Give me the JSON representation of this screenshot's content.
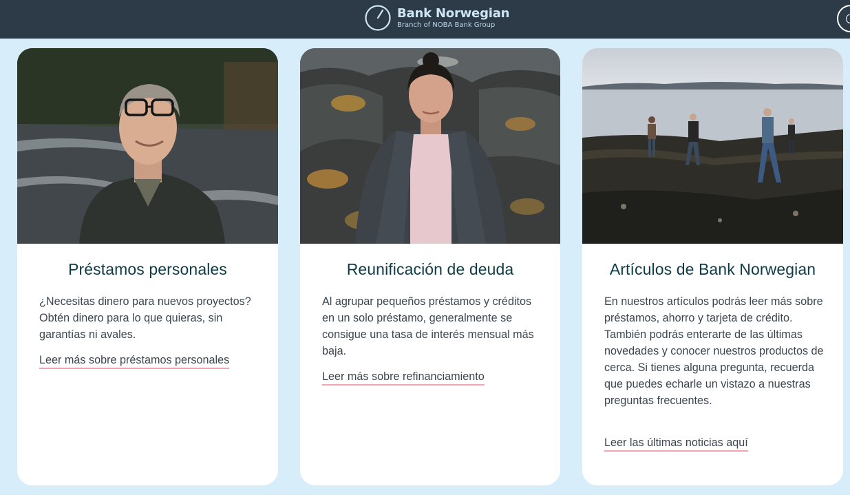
{
  "header": {
    "brand_name": "Bank Norwegian",
    "brand_subtitle": "Branch of NOBA Bank Group",
    "logo_icon": "bank-norwegian-logo-icon",
    "corner_icon": "user-icon",
    "background_color": "#2d3a47"
  },
  "cards": [
    {
      "image": "portrait-man-glasses-by-river",
      "title": "Préstamos personales",
      "body": "¿Necesitas dinero para nuevos proyectos? Obtén dinero para lo que quieras, sin garantías ni avales.",
      "link": "Leer más sobre préstamos personales"
    },
    {
      "image": "portrait-woman-on-rocks",
      "title": "Reunificación de deuda",
      "body": "Al agrupar pequeños préstamos y créditos en un solo préstamo, generalmente se consigue una tasa de interés mensual más baja.",
      "link": "Leer más sobre refinanciamiento"
    },
    {
      "image": "people-walking-on-seaweed-shore",
      "title": "Artículos de Bank Norwegian",
      "body": "En nuestros artículos podrás leer más sobre préstamos, ahorro y tarjeta de crédito. También podrás enterarte de las últimas novedades y conocer nuestros productos de cerca. Si tienes alguna pregunta, recuerda que puedes echarle un vistazo a nuestras preguntas frecuentes.",
      "link": "Leer las últimas noticias aquí"
    }
  ],
  "colors": {
    "page_background": "#d7eefa",
    "title_color": "#0f3b46",
    "link_underline": "#f0a6b2"
  }
}
